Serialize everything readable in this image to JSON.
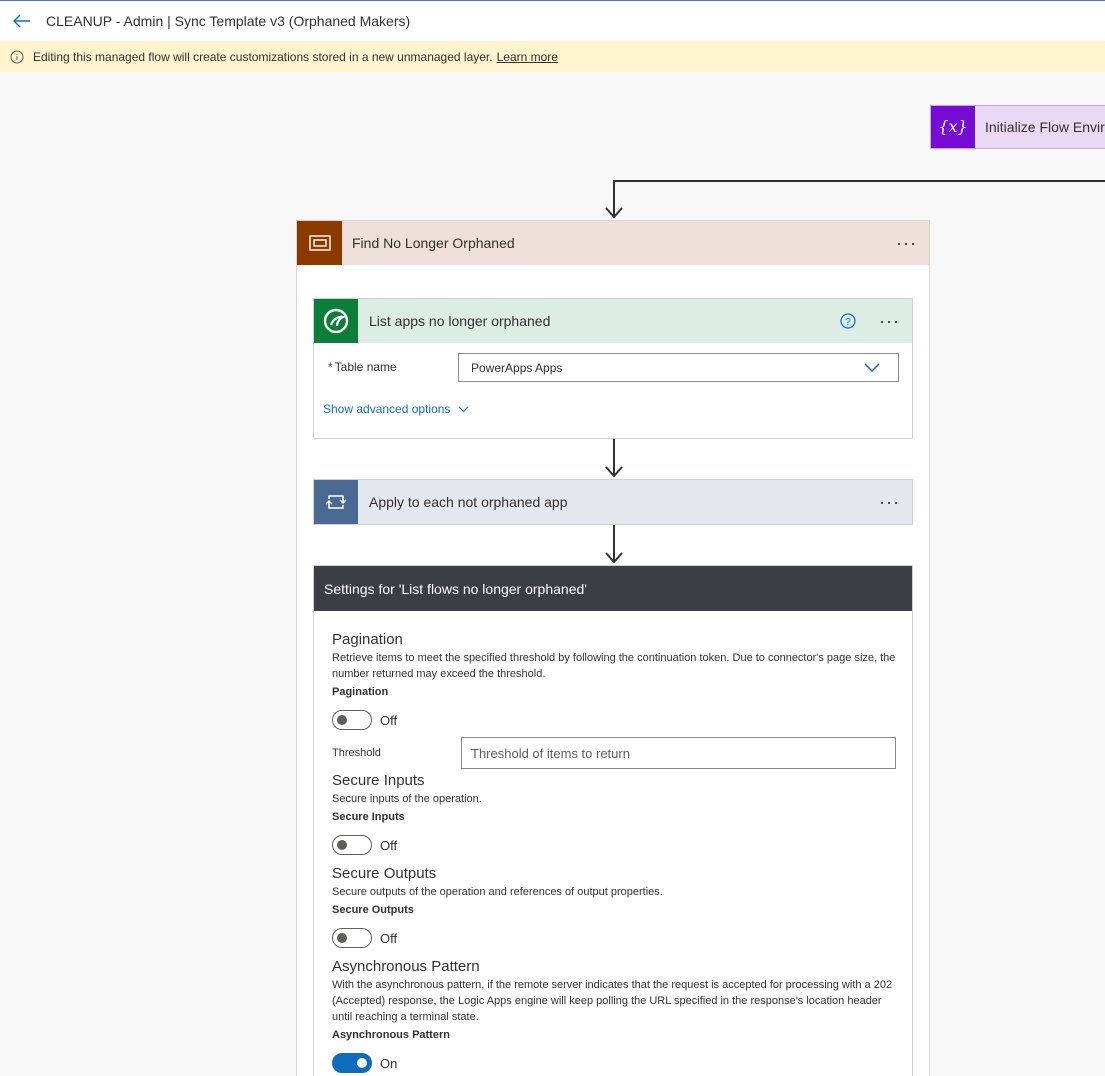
{
  "header": {
    "title": "CLEANUP - Admin | Sync Template v3 (Orphaned Makers)"
  },
  "banner": {
    "message": "Editing this managed flow will create customizations stored in a new unmanaged layer.",
    "link": "Learn more"
  },
  "init_card": {
    "label": "Initialize Flow Enviro"
  },
  "scope": {
    "title": "Find No Longer Orphaned",
    "more": "···"
  },
  "list_card": {
    "title": "List apps no longer orphaned",
    "more": "···",
    "table_label": "Table name",
    "required_mark": "*",
    "table_value": "PowerApps Apps",
    "advanced": "Show advanced options"
  },
  "apply_card": {
    "title": "Apply to each not orphaned app",
    "more": "···"
  },
  "settings": {
    "title": "Settings for 'List flows no longer orphaned'",
    "pagination": {
      "title": "Pagination",
      "desc": "Retrieve items to meet the specified threshold by following the continuation token. Due to connector's page size, the number returned may exceed the threshold.",
      "sub": "Pagination",
      "state": "Off"
    },
    "threshold": {
      "label": "Threshold",
      "placeholder": "Threshold of items to return"
    },
    "secure_inputs": {
      "title": "Secure Inputs",
      "desc": "Secure inputs of the operation.",
      "sub": "Secure Inputs",
      "state": "Off"
    },
    "secure_outputs": {
      "title": "Secure Outputs",
      "desc": "Secure outputs of the operation and references of output properties.",
      "sub": "Secure Outputs",
      "state": "Off"
    },
    "async": {
      "title": "Asynchronous Pattern",
      "desc": "With the asynchronous pattern, if the remote server indicates that the request is accepted for processing with a 202 (Accepted) response, the Logic Apps engine will keep polling the URL specified in the response's location header until reaching a terminal state.",
      "sub": "Asynchronous Pattern",
      "state": "On"
    }
  },
  "colors": {
    "accent": "#0f6cbd",
    "banner_bg": "#fff4ce",
    "scope_icon": "#8c3900",
    "dataverse_icon": "#0b7f3a",
    "loop_icon": "#486991",
    "variable_icon": "#770bd6",
    "settings_header": "#3b3e45"
  }
}
